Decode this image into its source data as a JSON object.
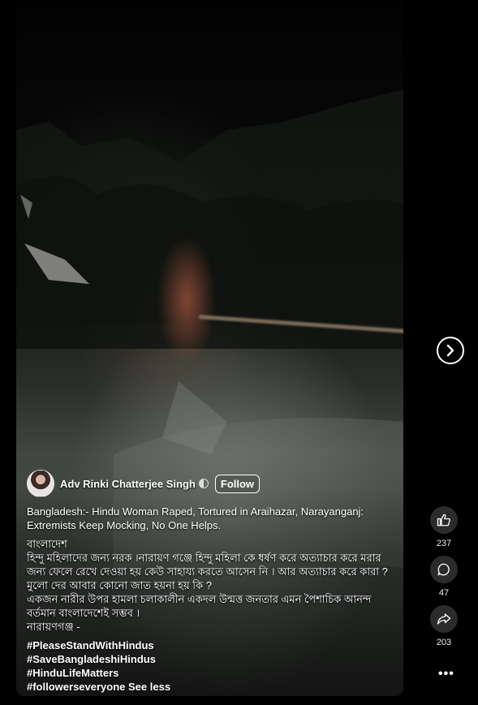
{
  "post": {
    "author_name": "Adv Rinki Chatterjee Singh",
    "follow_label": "Follow",
    "title_line": "Bangladesh:- Hindu Woman Raped, Tortured in Araihazar, Narayanganj: Extremists Keep Mocking, No One Helps.",
    "body_lines": [
      "বাংলাদেশ",
      "হিন্দু মহিলাদের জন্য নরক ।নারায়ণ গঞ্জে হিন্দু মহিলা কে ধর্ষণ করে অত্যাচার করে মরার জন্য ফেলে  রেখে দেওয়া হয় কেউ সাহায্য করতে আসেন নি । আর অত্যাচার করে কারা  ? মুলো দের আবার কোনো জাত হয়না হয় কি ?",
      "একজন নারীর উপর হামলা চলাকালীন একদল উন্মত্ত  জনতার এমন পৈশাচিক আনন্দ বর্তমান বাংলাদেশেই সম্ভব ।",
      "নারায়ণগঞ্জ  -"
    ],
    "hashtags": [
      "#PleaseStandWithHindus",
      "#SaveBangladeshiHindus",
      "#HinduLifeMatters",
      "#followerseveryone"
    ],
    "see_less_label": "See less"
  },
  "actions": {
    "like_count": "237",
    "comment_count": "47",
    "share_count": "203"
  },
  "icons": {
    "like": "thumbs-up-icon",
    "comment": "comment-icon",
    "share": "share-icon",
    "more": "more-options-icon",
    "next": "next-chevron-icon"
  },
  "colors": {
    "background": "#000000",
    "action_circle": "#2b2b2b",
    "text": "#ffffff"
  }
}
